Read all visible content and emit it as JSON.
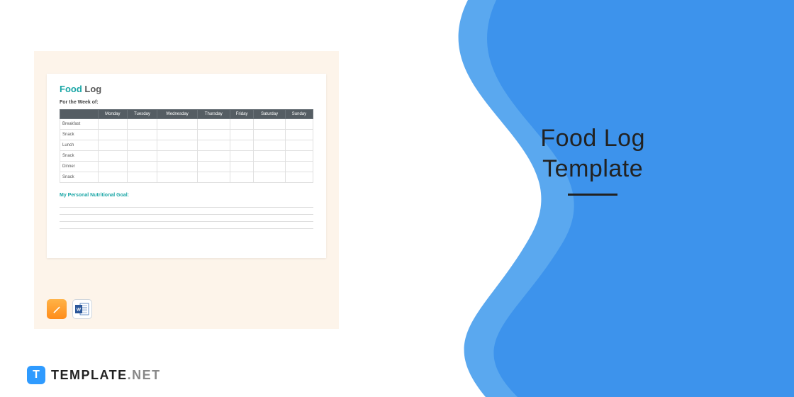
{
  "preview": {
    "title_word1": "Food",
    "title_word2": "Log",
    "subheading": "For the Week of:",
    "columns": [
      "",
      "Monday",
      "Tuesday",
      "Wednesday",
      "Thursday",
      "Friday",
      "Saturday",
      "Sunday"
    ],
    "rows": [
      "Breakfast",
      "Snack",
      "Lunch",
      "Snack",
      "Dinner",
      "Snack"
    ],
    "goal_label": "My Personal Nutritional Goal:"
  },
  "icons": {
    "pages": "pages-icon",
    "word": "word-icon"
  },
  "headline": {
    "line1": "Food Log",
    "line2": "Template"
  },
  "brand": {
    "badge": "T",
    "name": "TEMPLATE",
    "suffix": ".NET"
  }
}
